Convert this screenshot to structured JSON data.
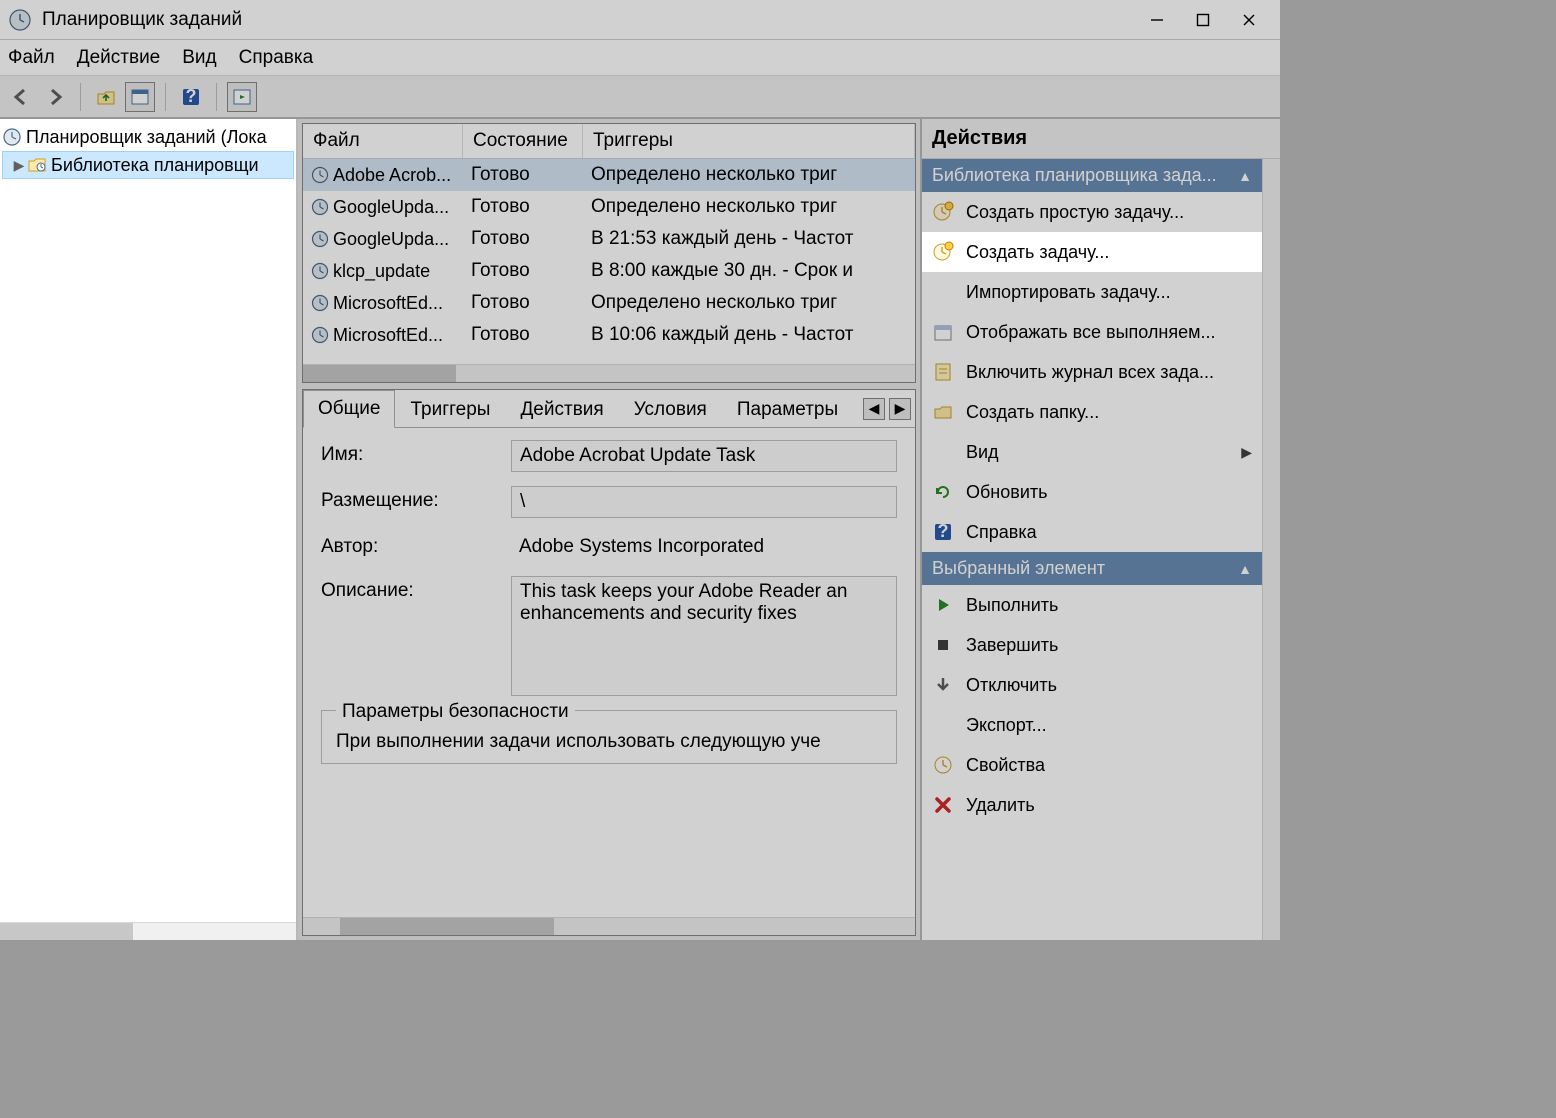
{
  "title": "Планировщик заданий",
  "menu": {
    "file": "Файл",
    "action": "Действие",
    "view": "Вид",
    "help": "Справка"
  },
  "tree": {
    "root": "Планировщик заданий (Лока",
    "library": "Библиотека планировщи"
  },
  "taskList": {
    "columns": {
      "file": "Файл",
      "state": "Состояние",
      "triggers": "Триггеры"
    },
    "rows": [
      {
        "file": "Adobe Acrob...",
        "state": "Готово",
        "trig": "Определено несколько триг"
      },
      {
        "file": "GoogleUpda...",
        "state": "Готово",
        "trig": "Определено несколько триг"
      },
      {
        "file": "GoogleUpda...",
        "state": "Готово",
        "trig": "В 21:53 каждый день - Частот"
      },
      {
        "file": "klcp_update",
        "state": "Готово",
        "trig": "В 8:00 каждые 30 дн. - Срок и"
      },
      {
        "file": "MicrosoftEd...",
        "state": "Готово",
        "trig": "Определено несколько триг"
      },
      {
        "file": "MicrosoftEd...",
        "state": "Готово",
        "trig": "В 10:06 каждый день - Частот"
      }
    ]
  },
  "detailTabs": {
    "general": "Общие",
    "triggers": "Триггеры",
    "actions": "Действия",
    "conditions": "Условия",
    "settings": "Параметры"
  },
  "detail": {
    "nameLabel": "Имя:",
    "name": "Adobe Acrobat Update Task",
    "locationLabel": "Размещение:",
    "location": "\\",
    "authorLabel": "Автор:",
    "author": "Adobe Systems Incorporated",
    "descLabel": "Описание:",
    "desc": "This task keeps your Adobe Reader an enhancements and security fixes",
    "securityLegend": "Параметры безопасности",
    "securityText": "При выполнении задачи использовать следующую уче"
  },
  "actions": {
    "header": "Действия",
    "sectionA": "Библиотека планировщика зада...",
    "itemsA": [
      {
        "label": "Создать простую задачу...",
        "icon": "clock-new"
      },
      {
        "label": "Создать задачу...",
        "icon": "clock-new",
        "highlight": true
      },
      {
        "label": "Импортировать задачу...",
        "icon": "none"
      },
      {
        "label": "Отображать все выполняем...",
        "icon": "calendar"
      },
      {
        "label": "Включить журнал всех зада...",
        "icon": "journal"
      },
      {
        "label": "Создать папку...",
        "icon": "folder"
      },
      {
        "label": "Вид",
        "icon": "none",
        "chev": true
      },
      {
        "label": "Обновить",
        "icon": "refresh"
      },
      {
        "label": "Справка",
        "icon": "help"
      }
    ],
    "sectionB": "Выбранный элемент",
    "itemsB": [
      {
        "label": "Выполнить",
        "icon": "play"
      },
      {
        "label": "Завершить",
        "icon": "stop"
      },
      {
        "label": "Отключить",
        "icon": "disable"
      },
      {
        "label": "Экспорт...",
        "icon": "none"
      },
      {
        "label": "Свойства",
        "icon": "props"
      },
      {
        "label": "Удалить",
        "icon": "delete"
      }
    ]
  }
}
